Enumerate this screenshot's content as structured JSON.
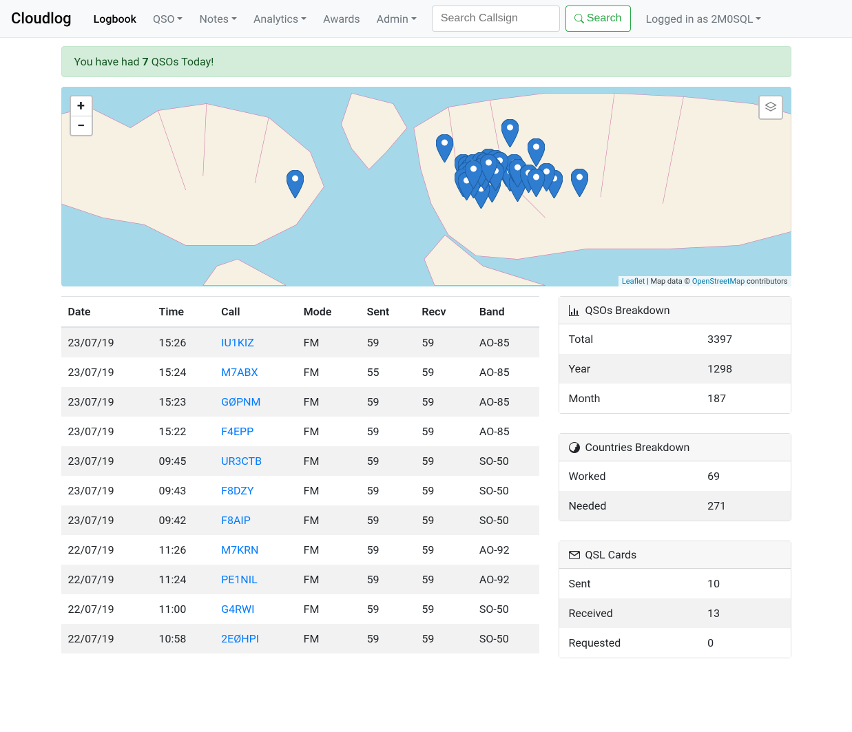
{
  "brand": "Cloudlog",
  "nav": {
    "logbook": "Logbook",
    "qso": "QSO",
    "notes": "Notes",
    "analytics": "Analytics",
    "awards": "Awards",
    "admin": "Admin"
  },
  "search": {
    "placeholder": "Search Callsign",
    "button": "Search"
  },
  "auth": {
    "label": "Logged in as 2M0SQL"
  },
  "alert": {
    "prefix": "You have had ",
    "count": "7",
    "suffix": " QSOs Today!"
  },
  "map": {
    "zoom_in": "+",
    "zoom_out": "−",
    "leaflet": "Leaflet",
    "sep": " | Map data © ",
    "osm": "OpenStreetMap",
    "suffix": " contributors",
    "markers": [
      [
        32,
        56
      ],
      [
        52.5,
        38
      ],
      [
        71,
        55
      ],
      [
        67.5,
        56
      ],
      [
        61.5,
        30.5
      ],
      [
        65,
        40
      ],
      [
        66.5,
        52.5
      ],
      [
        55,
        48
      ],
      [
        55.5,
        49
      ],
      [
        57,
        48.5
      ],
      [
        57,
        55
      ],
      [
        58.5,
        45
      ],
      [
        58.5,
        50.5
      ],
      [
        59,
        55
      ],
      [
        59.5,
        46
      ],
      [
        61,
        50
      ],
      [
        61.5,
        52.5
      ],
      [
        59,
        58
      ],
      [
        62.5,
        57.5
      ],
      [
        57.5,
        61
      ],
      [
        56,
        50
      ],
      [
        56.5,
        48
      ],
      [
        57.5,
        47
      ],
      [
        58,
        47.5
      ],
      [
        55.5,
        52
      ],
      [
        56,
        53
      ],
      [
        57,
        52
      ],
      [
        58,
        52
      ],
      [
        56.5,
        56
      ],
      [
        55,
        55
      ],
      [
        55.5,
        57
      ],
      [
        62,
        48
      ],
      [
        62.5,
        50.5
      ],
      [
        64,
        53
      ],
      [
        65,
        55
      ],
      [
        60,
        47
      ],
      [
        59,
        49.5
      ],
      [
        59.5,
        52
      ],
      [
        57.5,
        50
      ],
      [
        58.5,
        48
      ],
      [
        56.5,
        51
      ]
    ]
  },
  "table": {
    "headers": {
      "date": "Date",
      "time": "Time",
      "call": "Call",
      "mode": "Mode",
      "sent": "Sent",
      "recv": "Recv",
      "band": "Band"
    },
    "rows": [
      {
        "date": "23/07/19",
        "time": "15:26",
        "call": "IU1KIZ",
        "mode": "FM",
        "sent": "59",
        "recv": "59",
        "band": "AO-85"
      },
      {
        "date": "23/07/19",
        "time": "15:24",
        "call": "M7ABX",
        "mode": "FM",
        "sent": "55",
        "recv": "59",
        "band": "AO-85"
      },
      {
        "date": "23/07/19",
        "time": "15:23",
        "call": "GØPNM",
        "mode": "FM",
        "sent": "59",
        "recv": "59",
        "band": "AO-85"
      },
      {
        "date": "23/07/19",
        "time": "15:22",
        "call": "F4EPP",
        "mode": "FM",
        "sent": "59",
        "recv": "59",
        "band": "AO-85"
      },
      {
        "date": "23/07/19",
        "time": "09:45",
        "call": "UR3CTB",
        "mode": "FM",
        "sent": "59",
        "recv": "59",
        "band": "SO-50"
      },
      {
        "date": "23/07/19",
        "time": "09:43",
        "call": "F8DZY",
        "mode": "FM",
        "sent": "59",
        "recv": "59",
        "band": "SO-50"
      },
      {
        "date": "23/07/19",
        "time": "09:42",
        "call": "F8AIP",
        "mode": "FM",
        "sent": "59",
        "recv": "59",
        "band": "SO-50"
      },
      {
        "date": "22/07/19",
        "time": "11:26",
        "call": "M7KRN",
        "mode": "FM",
        "sent": "59",
        "recv": "59",
        "band": "AO-92"
      },
      {
        "date": "22/07/19",
        "time": "11:24",
        "call": "PE1NIL",
        "mode": "FM",
        "sent": "59",
        "recv": "59",
        "band": "AO-92"
      },
      {
        "date": "22/07/19",
        "time": "11:00",
        "call": "G4RWI",
        "mode": "FM",
        "sent": "59",
        "recv": "59",
        "band": "SO-50"
      },
      {
        "date": "22/07/19",
        "time": "10:58",
        "call": "2EØHPI",
        "mode": "FM",
        "sent": "59",
        "recv": "59",
        "band": "SO-50"
      }
    ]
  },
  "cards": {
    "qsos": {
      "title": "QSOs Breakdown",
      "rows": [
        {
          "label": "Total",
          "value": "3397"
        },
        {
          "label": "Year",
          "value": "1298"
        },
        {
          "label": "Month",
          "value": "187"
        }
      ]
    },
    "countries": {
      "title": "Countries Breakdown",
      "rows": [
        {
          "label": "Worked",
          "value": "69"
        },
        {
          "label": "Needed",
          "value": "271"
        }
      ]
    },
    "qsl": {
      "title": "QSL Cards",
      "rows": [
        {
          "label": "Sent",
          "value": "10"
        },
        {
          "label": "Received",
          "value": "13"
        },
        {
          "label": "Requested",
          "value": "0"
        }
      ]
    }
  }
}
